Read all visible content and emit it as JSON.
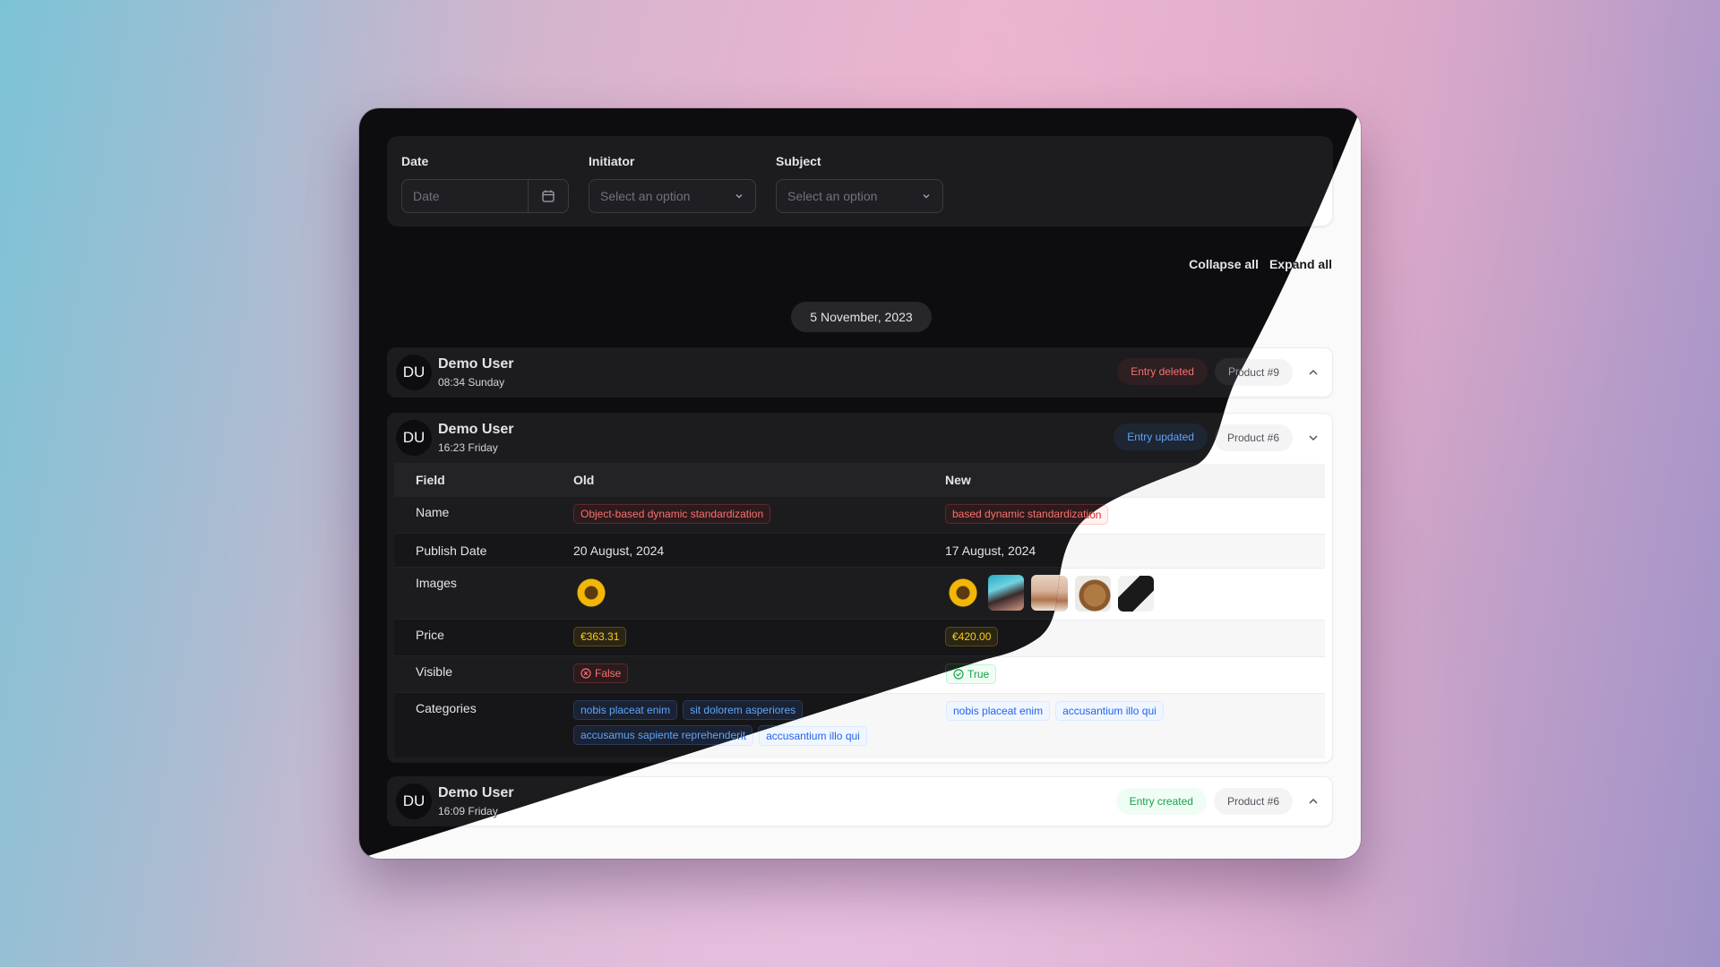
{
  "filters": {
    "date": {
      "label": "Date",
      "placeholder": "Date"
    },
    "initiator": {
      "label": "Initiator",
      "placeholder": "Select an option"
    },
    "subject": {
      "label": "Subject",
      "placeholder": "Select an option"
    }
  },
  "actions": {
    "collapse": "Collapse all",
    "expand": "Expand all"
  },
  "date_group": "5 November, 2023",
  "entries": [
    {
      "initials": "DU",
      "user": "Demo User",
      "time": "08:34 Sunday",
      "action": "Entry deleted",
      "subject": "Product #9",
      "expanded": false
    },
    {
      "initials": "DU",
      "user": "Demo User",
      "time": "16:23 Friday",
      "action": "Entry updated",
      "subject": "Product #6",
      "expanded": true
    },
    {
      "initials": "DU",
      "user": "Demo User",
      "time": "16:09 Friday",
      "action": "Entry created",
      "subject": "Product #6",
      "expanded": false
    }
  ],
  "diff": {
    "headers": {
      "field": "Field",
      "old": "Old",
      "new": "New"
    },
    "rows": {
      "name": {
        "field": "Name",
        "old": "Object-based dynamic standardization",
        "new": "based dynamic standardization"
      },
      "publish": {
        "field": "Publish Date",
        "old": "20 August, 2024",
        "new": "17 August, 2024"
      },
      "images": {
        "field": "Images",
        "old": [
          "sunflower"
        ],
        "new": [
          "sunflower",
          "woman-portrait",
          "woman-face",
          "straw-hat",
          "black-boot"
        ]
      },
      "price": {
        "field": "Price",
        "old": "€363.31",
        "new": "€420.00"
      },
      "visible": {
        "field": "Visible",
        "old": "False",
        "new": "True"
      },
      "categories": {
        "field": "Categories",
        "old": [
          "nobis placeat enim",
          "sit dolorem asperiores",
          "accusamus sapiente reprehenderit",
          "accusantium illo qui"
        ],
        "new": [
          "nobis placeat enim",
          "accusantium illo qui"
        ]
      }
    }
  },
  "colors": {
    "deleted": "#dc2626",
    "updated": "#2563eb",
    "created": "#16a34a",
    "price": "#a16207"
  }
}
